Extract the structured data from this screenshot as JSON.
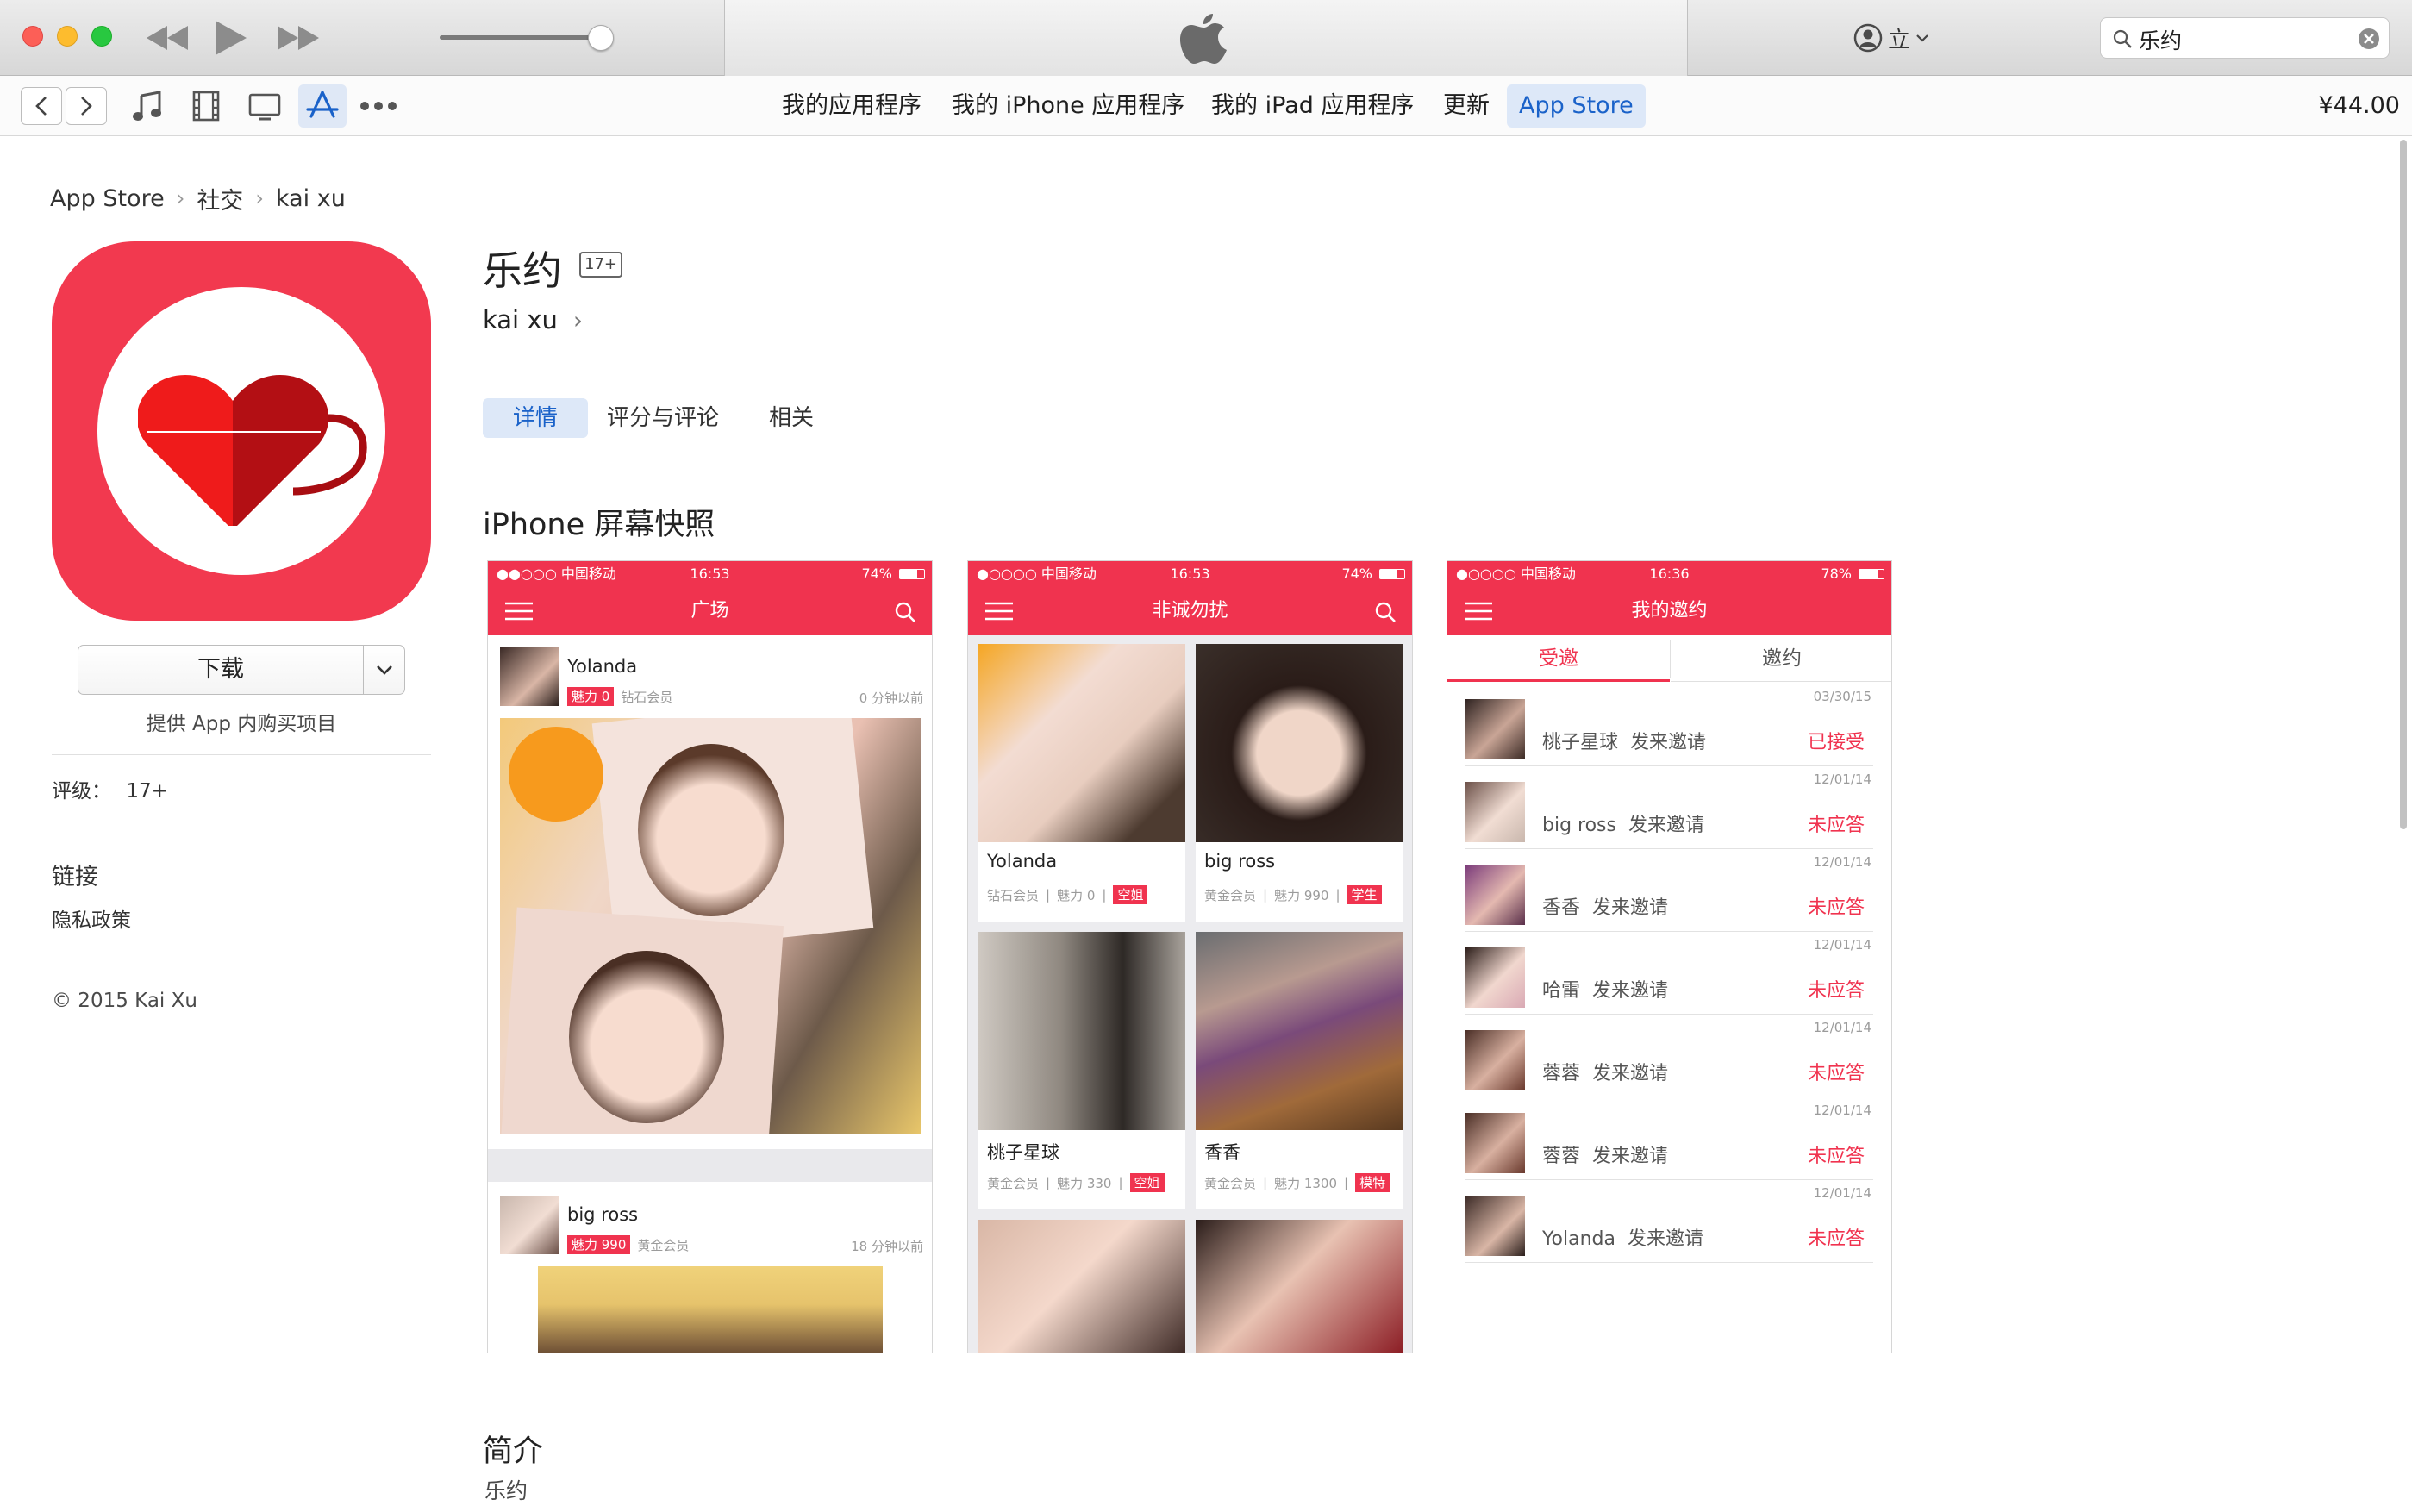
{
  "titlebar": {
    "account_label": "立",
    "search_value": "乐约"
  },
  "nav": {
    "tabs": [
      "我的应用程序",
      "我的 iPhone 应用程序",
      "我的 iPad 应用程序",
      "更新",
      "App Store"
    ],
    "price": "¥44.00"
  },
  "breadcrumb": [
    "App Store",
    "社交",
    "kai xu"
  ],
  "app": {
    "name": "乐约",
    "rating_badge": "17+",
    "developer": "kai xu"
  },
  "sidebar": {
    "download_label": "下载",
    "iap_note": "提供 App 内购买项目",
    "rating_label": "评级：",
    "rating_value": "17+",
    "links_heading": "链接",
    "privacy_link": "隐私政策",
    "copyright": "© 2015 Kai Xu"
  },
  "detail_tabs": [
    "详情",
    "评分与评论",
    "相关"
  ],
  "screenshots_heading": "iPhone 屏幕快照",
  "intro_heading": "简介",
  "intro_text": "乐约",
  "screen1": {
    "carrier": "●●○○○ 中国移动",
    "time": "16:53",
    "battery": "74%",
    "title": "广场",
    "post1": {
      "name": "Yolanda",
      "charm": "魅力 0",
      "level": "钻石会员",
      "time": "0 分钟以前"
    },
    "post2": {
      "name": "big ross",
      "charm": "魅力 990",
      "level": "黄金会员",
      "time": "18 分钟以前"
    }
  },
  "screen2": {
    "carrier": "●○○○○ 中国移动",
    "time": "16:53",
    "battery": "74%",
    "title": "非诚勿扰",
    "cards": [
      {
        "name": "Yolanda",
        "level": "钻石会员",
        "charm": "魅力 0",
        "tag": "空姐"
      },
      {
        "name": "big ross",
        "level": "黄金会员",
        "charm": "魅力 990",
        "tag": "学生"
      },
      {
        "name": "桃子星球",
        "level": "黄金会员",
        "charm": "魅力 330",
        "tag": "空姐"
      },
      {
        "name": "香香",
        "level": "黄金会员",
        "charm": "魅力 1300",
        "tag": "模特"
      }
    ]
  },
  "screen3": {
    "carrier": "●○○○○ 中国移动",
    "time": "16:36",
    "battery": "78%",
    "title": "我的邀约",
    "tabs": [
      "受邀",
      "邀约"
    ],
    "rows": [
      {
        "date": "03/30/15",
        "name": "桃子星球",
        "action": "发来邀请",
        "status": "已接受"
      },
      {
        "date": "12/01/14",
        "name": "big ross",
        "action": "发来邀请",
        "status": "未应答"
      },
      {
        "date": "12/01/14",
        "name": "香香",
        "action": "发来邀请",
        "status": "未应答"
      },
      {
        "date": "12/01/14",
        "name": "哈雷",
        "action": "发来邀请",
        "status": "未应答"
      },
      {
        "date": "12/01/14",
        "name": "蓉蓉",
        "action": "发来邀请",
        "status": "未应答"
      },
      {
        "date": "12/01/14",
        "name": "蓉蓉",
        "action": "发来邀请",
        "status": "未应答"
      },
      {
        "date": "12/01/14",
        "name": "Yolanda",
        "action": "发来邀请",
        "status": "未应答"
      }
    ]
  },
  "colors": {
    "accent": "#f0334f",
    "link_blue": "#1a62c9",
    "icon_bg": "#f2394f"
  }
}
